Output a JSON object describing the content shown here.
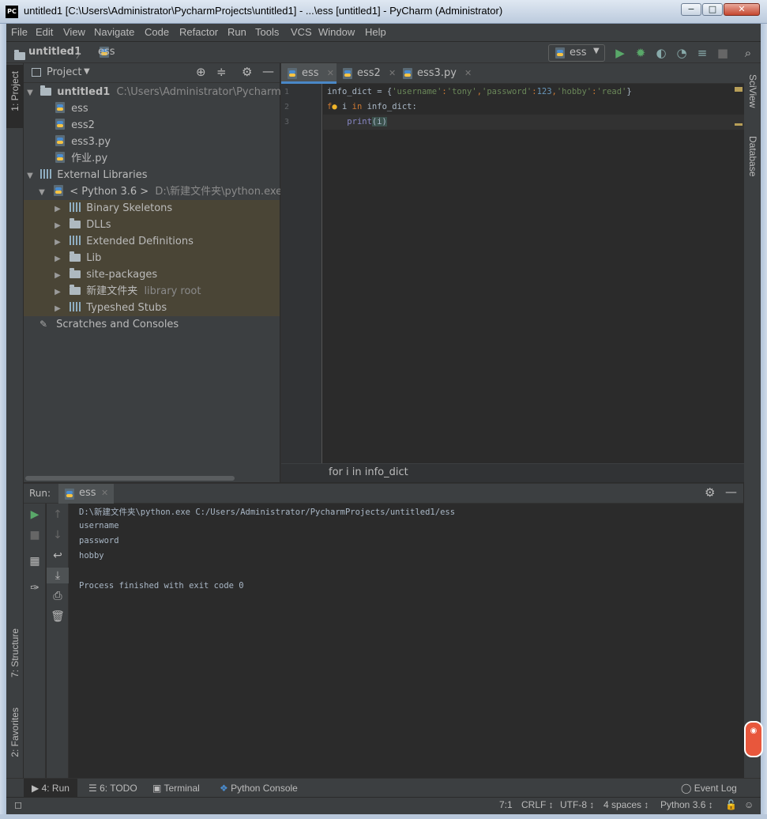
{
  "window": {
    "title": "untitled1 [C:\\Users\\Administrator\\PycharmProjects\\untitled1] - ...\\ess [untitled1] - PyCharm (Administrator)",
    "app_icon": "PC",
    "min": "−",
    "max": "□",
    "close": "✕"
  },
  "menu": [
    "File",
    "Edit",
    "View",
    "Navigate",
    "Code",
    "Refactor",
    "Run",
    "Tools",
    "VCS",
    "Window",
    "Help"
  ],
  "navbar": {
    "project": "untitled1",
    "separator": "〉",
    "file": "ess",
    "run_config": "ess"
  },
  "stripes": {
    "left_top": "1: Project",
    "left_structure": "7: Structure",
    "left_favorites": "2: Favorites",
    "right_sciview": "SciView",
    "right_database": "Database"
  },
  "project": {
    "header": "Project",
    "root": {
      "name": "untitled1",
      "path": "C:\\Users\\Administrator\\PycharmProjec"
    },
    "files": [
      "ess",
      "ess2",
      "ess3.py",
      "作业.py"
    ],
    "external_libraries": "External Libraries",
    "python": {
      "name": "< Python 3.6 >",
      "path": "D:\\新建文件夹\\python.exe"
    },
    "lib_items": [
      {
        "name": "Binary Skeletons",
        "icon": "library-icon",
        "suffix": ""
      },
      {
        "name": "DLLs",
        "icon": "folder-icon",
        "suffix": ""
      },
      {
        "name": "Extended Definitions",
        "icon": "library-icon",
        "suffix": ""
      },
      {
        "name": "Lib",
        "icon": "folder-icon",
        "suffix": ""
      },
      {
        "name": "site-packages",
        "icon": "folder-icon",
        "suffix": ""
      },
      {
        "name": "新建文件夹",
        "icon": "folder-icon",
        "suffix": "library root"
      },
      {
        "name": "Typeshed Stubs",
        "icon": "library-icon",
        "suffix": ""
      }
    ],
    "scratches": "Scratches and Consoles"
  },
  "editor": {
    "tabs": [
      {
        "label": "ess",
        "active": true
      },
      {
        "label": "ess2",
        "active": false
      },
      {
        "label": "ess3.py",
        "active": false
      }
    ],
    "line_numbers": [
      "1",
      "2",
      "3"
    ],
    "code": {
      "line1": {
        "var": "info_dict",
        "op": " = {",
        "k1": "'username'",
        "c1": ":",
        "v1": "'tony'",
        "s1": ",",
        "k2": "'password'",
        "c2": ":",
        "v2": "123",
        "s2": ",",
        "k3": "'hobby'",
        "c3": ":",
        "v3": "'read'",
        "end": "}"
      },
      "line2": {
        "kw_for_pre": "f",
        "kw_for_post": "r",
        "var": " i ",
        "kw_in": "in",
        "rest": " info_dict:"
      },
      "line3": {
        "indent": "    ",
        "fn": "print",
        "args": "(i)"
      }
    },
    "breadcrumb": "for i in info_dict"
  },
  "run": {
    "label": "Run:",
    "tab": "ess",
    "output": [
      "D:\\新建文件夹\\python.exe C:/Users/Administrator/PycharmProjects/untitled1/ess",
      "username",
      "password",
      "hobby",
      "",
      "Process finished with exit code 0"
    ]
  },
  "bottom_tabs": {
    "run": "4: Run",
    "todo": "6: TODO",
    "terminal": "Terminal",
    "python_console": "Python Console",
    "event_log": "Event Log"
  },
  "status": {
    "position": "7:1",
    "line_sep": "CRLF ↕",
    "encoding": "UTF-8 ↕",
    "indent": "4 spaces ↕",
    "interpreter": "Python 3.6 ↕"
  },
  "colors": {
    "background": "#2b2b2b",
    "panel": "#3c3f41",
    "keyword": "#cc7832",
    "string": "#6a8759",
    "number": "#6897bb",
    "library_highlight": "#4a4536",
    "run_green": "#59a869"
  }
}
